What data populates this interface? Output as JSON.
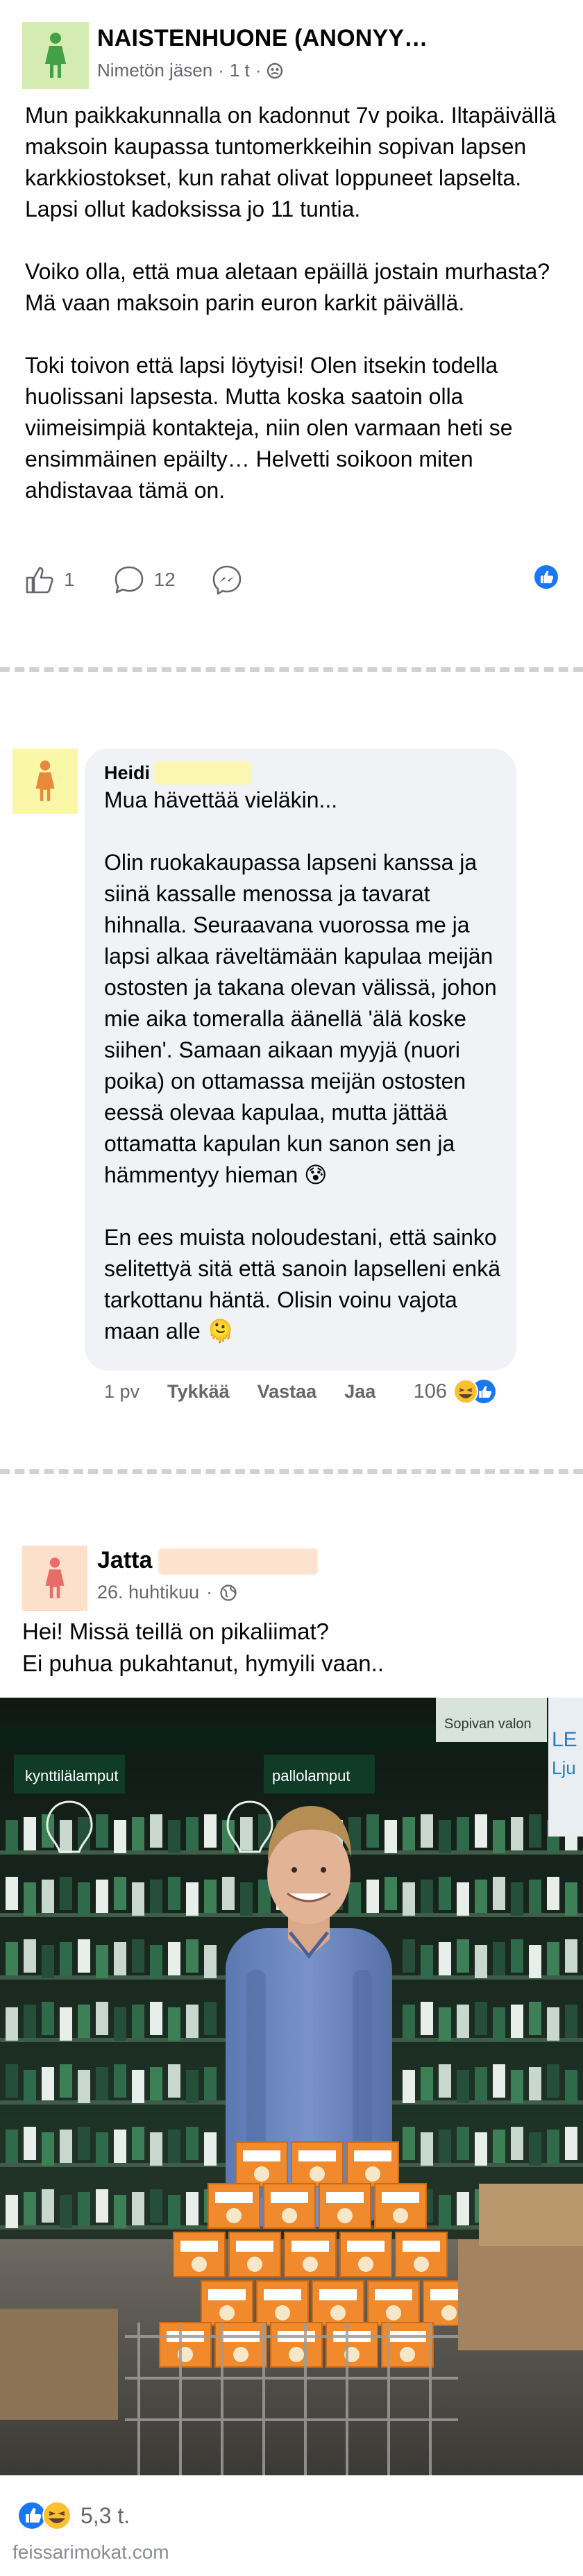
{
  "post1": {
    "group_name": "NAISTENHUONE (ANONYY…",
    "author": "Nimetön jäsen",
    "time": "1 t",
    "paragraphs": [
      "Mun paikkakunnalla on kadonnut 7v poika. Iltapäivällä maksoin kaupassa tuntomerkkeihin sopivan lapsen karkkiostokset, kun rahat olivat loppuneet lapselta. Lapsi ollut kadoksissa jo 11 tuntia.",
      "Voiko olla, että mua aletaan epäillä jostain murhasta? Mä vaan maksoin parin euron karkit päivällä.",
      "Toki toivon että lapsi löytyisi! Olen itsekin todella huolissani lapsesta. Mutta koska saatoin olla viimeisimpiä kontakteja, niin olen varmaan heti se ensimmäinen epäilty… Helvetti soikoon miten ahdistavaa tämä on."
    ],
    "like_count": "1",
    "comment_count": "12",
    "icons": [
      "person-icon",
      "globe-off-icon",
      "like-icon",
      "comment-icon",
      "messenger-icon",
      "like-reaction-icon"
    ]
  },
  "comment": {
    "author": "Heidi",
    "paragraphs": [
      "Mua hävettää vieläkin...",
      "Olin ruokakaupassa lapseni kanssa ja siinä kassalle menossa ja tavarat hihnalla. Seuraavana vuorossa me ja lapsi alkaa räveltämään kapulaa meijän ostosten ja takana olevan välissä, johon mie aika tomeralla äänellä 'älä koske siihen'. Samaan aikaan myyjä (nuori poika) on ottamassa meijän ostosten eessä olevaa kapulaa, mutta jättää ottamatta kapulan kun sanon sen ja hämmentyy hieman 😰",
      "En ees muista noloudestani, että sainko selitettyä sitä että sanoin lapselleni enkä tarkottanu häntä. Olisin voinu vajota maan alle 🫠"
    ],
    "time": "1 pv",
    "like_label": "Tykkää",
    "reply_label": "Vastaa",
    "share_label": "Jaa",
    "reaction_count": "106"
  },
  "post3": {
    "author": "Jatta",
    "date": "26. huhtikuu",
    "text_line1": "Hei! Missä teillä on pikaliimat?",
    "text_line2": "Ei puhua pukahtanut, hymyili vaan..",
    "photo_signs": [
      "kynttilälamput",
      "pallolamput",
      "Sopivan valon",
      "LE",
      "Lju"
    ],
    "reaction_count": "5,3 t."
  },
  "footer": {
    "source": "feissarimokat.com"
  },
  "colors": {
    "accent": "#1877f2",
    "avatar_green": "#d4ecb2",
    "avatar_yellow": "#fbf7a8",
    "avatar_peach": "#fde0cc",
    "figure_green": "#43a047",
    "figure_orange": "#e8893a",
    "figure_pink": "#e76d66"
  }
}
